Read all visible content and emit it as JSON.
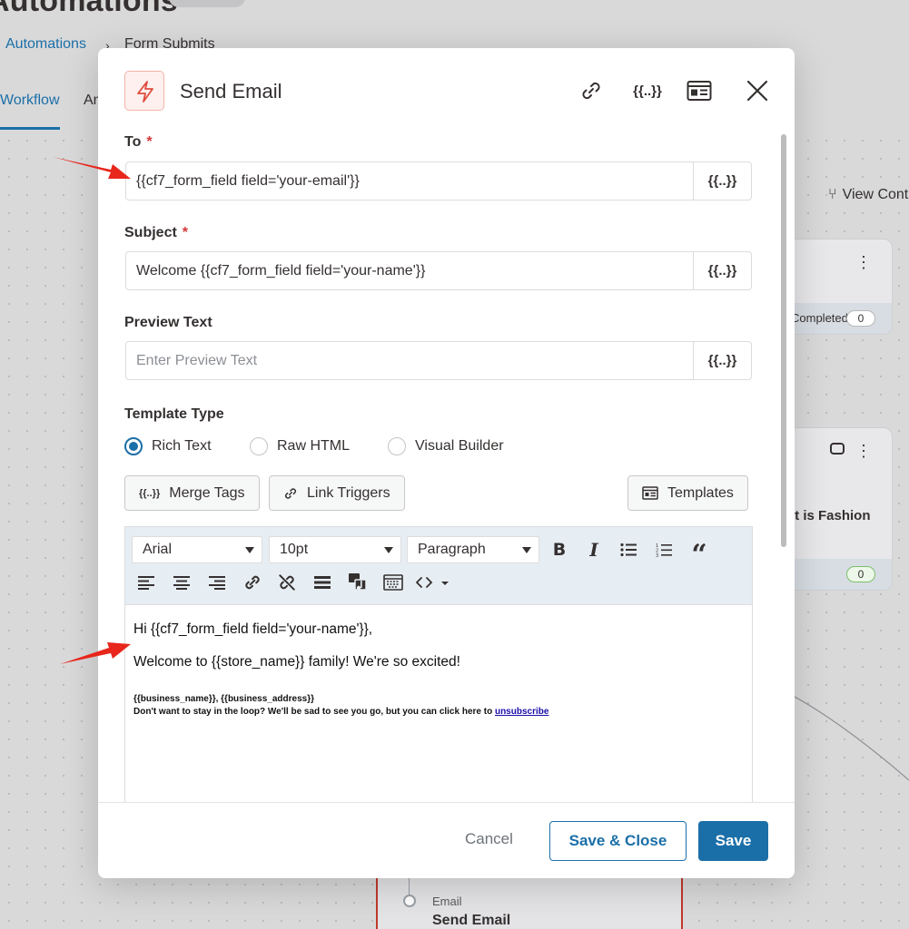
{
  "background": {
    "title": "Automations",
    "breadcrumb": {
      "root": "Automations",
      "separator": "›",
      "current": "Form Submits"
    },
    "tabs": [
      "Workflow",
      "Analytics"
    ],
    "view_link": "View Contacts",
    "card1": {
      "footer_text": "Completed",
      "count": "0"
    },
    "card2": {
      "title": "It is Fashion",
      "count": "0"
    },
    "node": {
      "kind": "Email",
      "title": "Send Email"
    }
  },
  "modal": {
    "title": "Send Email",
    "header_icons": [
      "link-icon",
      "merge-tag-icon",
      "preview-icon",
      "close-icon"
    ],
    "merge_tag_glyph": "{{..}}",
    "to": {
      "label": "To",
      "required": "*",
      "value": "{{cf7_form_field field='your-email'}}"
    },
    "subject": {
      "label": "Subject",
      "required": "*",
      "value": "Welcome {{cf7_form_field field='your-name'}}"
    },
    "preview": {
      "label": "Preview Text",
      "placeholder": "Enter Preview Text",
      "value": ""
    },
    "template_type": {
      "label": "Template Type",
      "options": [
        "Rich Text",
        "Raw HTML",
        "Visual Builder"
      ],
      "selected": "Rich Text"
    },
    "actions": {
      "merge_tags": "Merge Tags",
      "link_triggers": "Link Triggers",
      "templates": "Templates"
    },
    "toolbar": {
      "font": "Arial",
      "size": "10pt",
      "block": "Paragraph",
      "row1_buttons": [
        "bold-icon",
        "italic-icon",
        "bullet-list-icon",
        "numbered-list-icon",
        "blockquote-icon"
      ],
      "row2_buttons": [
        "align-left-icon",
        "align-center-icon",
        "align-right-icon",
        "insert-link-icon",
        "unlink-icon",
        "horizontal-rule-icon",
        "media-icon",
        "keyboard-icon",
        "code-icon"
      ]
    },
    "body": {
      "line1": "Hi {{cf7_form_field field='your-name'}},",
      "line2": "Welcome to {{store_name}} family! We're so excited!",
      "line3": "{{business_name}}, {{business_address}}",
      "line4_prefix": "Don't want to stay in the loop? We'll be sad to see you go, but you can click here to ",
      "line4_link": "unsubscribe"
    },
    "footer": {
      "cancel": "Cancel",
      "save_close": "Save & Close",
      "save": "Save"
    }
  },
  "colors": {
    "accent": "#1b6fa8",
    "required": "#d63638",
    "annotation_arrow": "#e8261c",
    "bolt": "#e04b3c"
  }
}
